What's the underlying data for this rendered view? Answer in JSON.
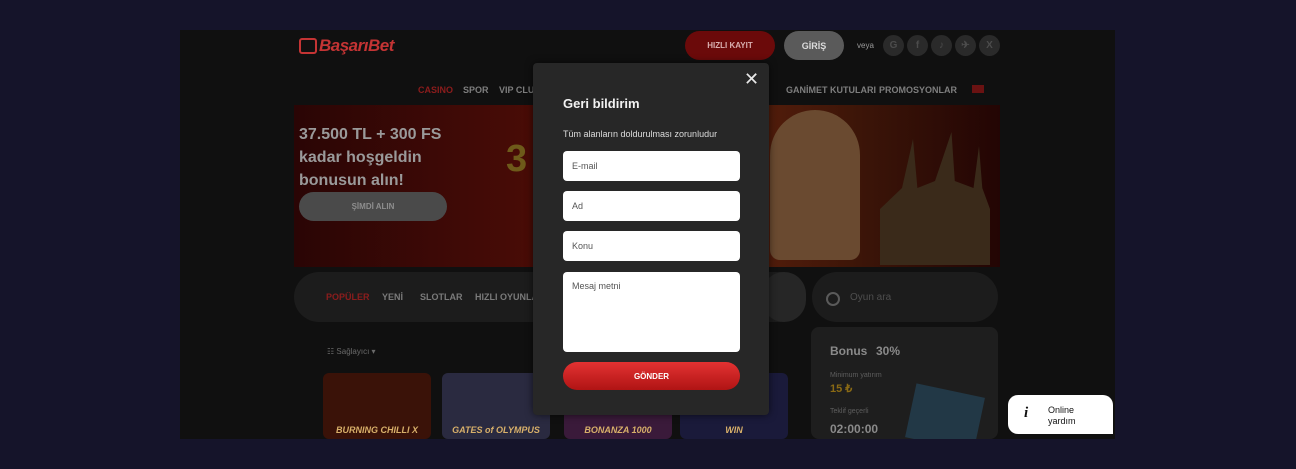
{
  "header": {
    "logo": "BaşarıBet",
    "register_label": "HIZLI KAYIT",
    "login_label": "GİRİŞ",
    "or_label": "veya",
    "social": [
      "G",
      "f",
      "♪",
      "✈",
      "X"
    ],
    "social_icons": [
      "google-icon",
      "facebook-icon",
      "tiktok-icon",
      "telegram-icon",
      "x-icon"
    ]
  },
  "nav": {
    "items": [
      "CASINO",
      "SPOR",
      "VIP CLUB",
      "GANİMET KUTULARI",
      "PROMOSYONLAR"
    ]
  },
  "banner": {
    "headline": "37.500 TL + 300 FS kadar hoşgeldin bonusun alın!",
    "cta": "ŞİMDİ ALIN",
    "big_number": "3"
  },
  "games": {
    "tabs": [
      "POPÜLER",
      "YENİ",
      "SLOTLAR",
      "HIZLI OYUNLAR"
    ],
    "search_placeholder": "Oyun ara",
    "sort_label": "Sağlayıcı",
    "tiles": [
      "BURNING CHILLI X",
      "GATES of OLYMPUS",
      "BONANZA 1000",
      "WIN"
    ]
  },
  "bonus": {
    "title": "Bonus",
    "percent": "30%",
    "min_deposit_label": "Minimum yatırım",
    "min_deposit_value": "15 ₺",
    "offer_label": "Teklif geçerli",
    "timer": "02:00:00"
  },
  "modal": {
    "title": "Geri bildirim",
    "subtitle": "Tüm alanların doldurulması zorunludur",
    "email_placeholder": "E-mail",
    "name_placeholder": "Ad",
    "subject_placeholder": "Konu",
    "message_placeholder": "Mesaj metni",
    "submit_label": "GÖNDER",
    "close_symbol": "✕"
  },
  "help": {
    "icon": "i",
    "label": "Online yardım"
  },
  "colors": {
    "page_bg": "#15142a",
    "accent": "#e33232",
    "modal_bg": "#272727"
  }
}
